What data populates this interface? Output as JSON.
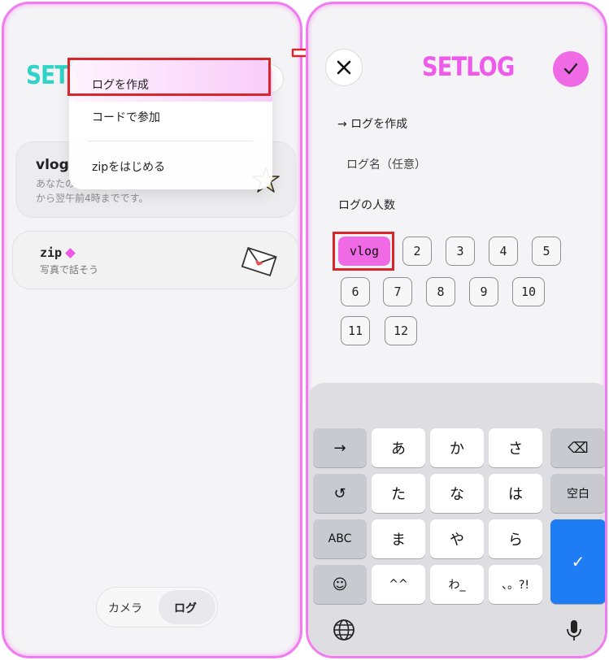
{
  "left": {
    "logo": "SETL",
    "menu": {
      "items": [
        "ログを作成",
        "コードで参加",
        "zipをはじめる"
      ]
    },
    "cards": [
      {
        "title": "vlog",
        "desc": "あなたの\nから翌午前4時までです。"
      },
      {
        "title": "zip",
        "desc": "写真で話そう"
      }
    ],
    "segment": {
      "camera": "カメラ",
      "log": "ログ"
    }
  },
  "right": {
    "logo": "SETLOG",
    "create_label": "→ ログを作成",
    "name_placeholder": "ログ名（任意）",
    "count_label": "ログの人数",
    "counts": [
      "vlog",
      "2",
      "3",
      "4",
      "5",
      "6",
      "7",
      "8",
      "9",
      "10",
      "11",
      "12"
    ],
    "selected_count": "vlog",
    "keyboard": {
      "row1": [
        "→",
        "あ",
        "か",
        "さ",
        "⌫"
      ],
      "row2": [
        "↺",
        "た",
        "な",
        "は",
        "空白"
      ],
      "row3": [
        "ABC",
        "ま",
        "や",
        "ら"
      ],
      "row4": [
        "☺",
        "^^",
        "わ_",
        "、。?!"
      ],
      "enter": "✓",
      "globe": "globe-icon",
      "mic": "mic-icon"
    }
  },
  "colors": {
    "accent_pink": "#f06ae6",
    "teal_logo": "#2fd3c8",
    "highlight_red": "#d9262c",
    "enter_blue": "#1e7cf5"
  }
}
